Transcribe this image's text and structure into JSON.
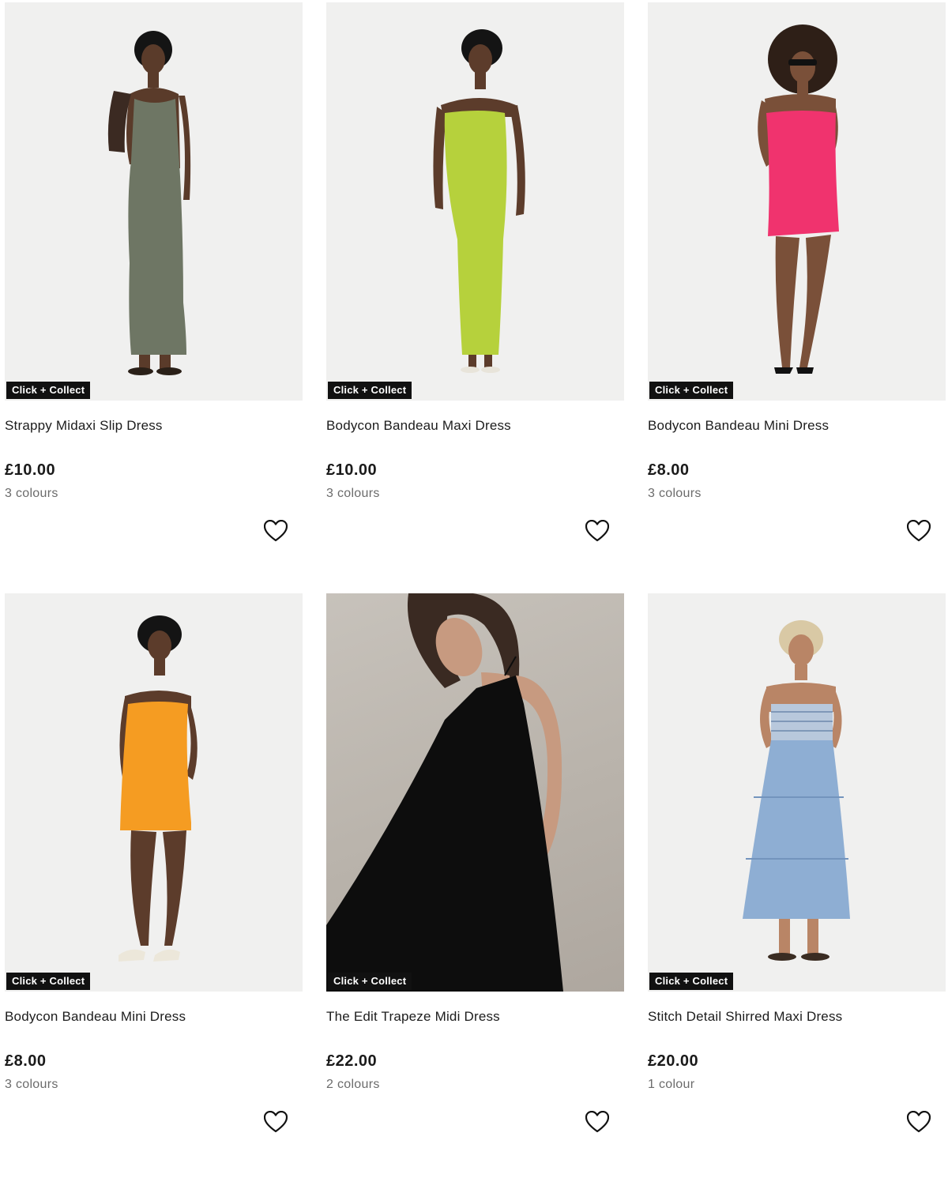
{
  "badge_label": "Click + Collect",
  "products": [
    {
      "name": "Strappy Midaxi Slip Dress",
      "price": "£10.00",
      "colours": "3 colours",
      "dress_color": "#6e7664",
      "skin_color": "#5a3b2a",
      "hair_color": "#141414"
    },
    {
      "name": "Bodycon Bandeau Maxi Dress",
      "price": "£10.00",
      "colours": "3 colours",
      "dress_color": "#b6d13c",
      "skin_color": "#5c3c2b",
      "hair_color": "#141414"
    },
    {
      "name": "Bodycon Bandeau Mini Dress",
      "price": "£8.00",
      "colours": "3 colours",
      "dress_color": "#f0336e",
      "skin_color": "#7a5039",
      "hair_color": "#2e1f17"
    },
    {
      "name": "Bodycon Bandeau Mini Dress",
      "price": "£8.00",
      "colours": "3 colours",
      "dress_color": "#f59c22",
      "skin_color": "#5c3c2b",
      "hair_color": "#141414"
    },
    {
      "name": "The Edit Trapeze Midi Dress",
      "price": "£22.00",
      "colours": "2 colours",
      "dress_color": "#0d0d0d",
      "skin_color": "#c79a80",
      "hair_color": "#3a2a22"
    },
    {
      "name": "Stitch Detail Shirred Maxi Dress",
      "price": "£20.00",
      "colours": "1 colour",
      "dress_color": "#8eaed3",
      "skin_color": "#b98566",
      "hair_color": "#d9c9a5"
    }
  ]
}
